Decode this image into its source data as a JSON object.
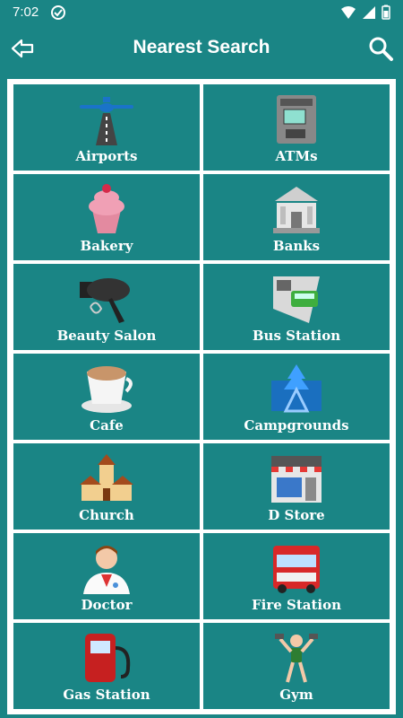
{
  "status": {
    "time": "7:02",
    "icons": [
      "sync-icon",
      "wifi-icon",
      "signal-icon",
      "battery-icon"
    ]
  },
  "app_bar": {
    "title": "Nearest Search",
    "back_icon": "back-arrow-icon",
    "search_icon": "search-icon"
  },
  "colors": {
    "accent": "#1a8585",
    "panel": "#ffffff",
    "text": "#ffffff"
  },
  "categories": [
    {
      "label": "Airports",
      "icon": "airplane-icon"
    },
    {
      "label": "ATMs",
      "icon": "atm-icon"
    },
    {
      "label": "Bakery",
      "icon": "cupcake-icon"
    },
    {
      "label": "Banks",
      "icon": "bank-icon"
    },
    {
      "label": "Beauty Salon",
      "icon": "hair-dryer-icon"
    },
    {
      "label": "Bus Station",
      "icon": "bus-stop-icon"
    },
    {
      "label": "Cafe",
      "icon": "coffee-cup-icon"
    },
    {
      "label": "Campgrounds",
      "icon": "campground-icon"
    },
    {
      "label": "Church",
      "icon": "church-icon"
    },
    {
      "label": "D Store",
      "icon": "store-icon"
    },
    {
      "label": "Doctor",
      "icon": "doctor-icon"
    },
    {
      "label": "Fire Station",
      "icon": "fire-truck-icon"
    },
    {
      "label": "Gas Station",
      "icon": "gas-pump-icon"
    },
    {
      "label": "Gym",
      "icon": "gym-icon"
    }
  ]
}
